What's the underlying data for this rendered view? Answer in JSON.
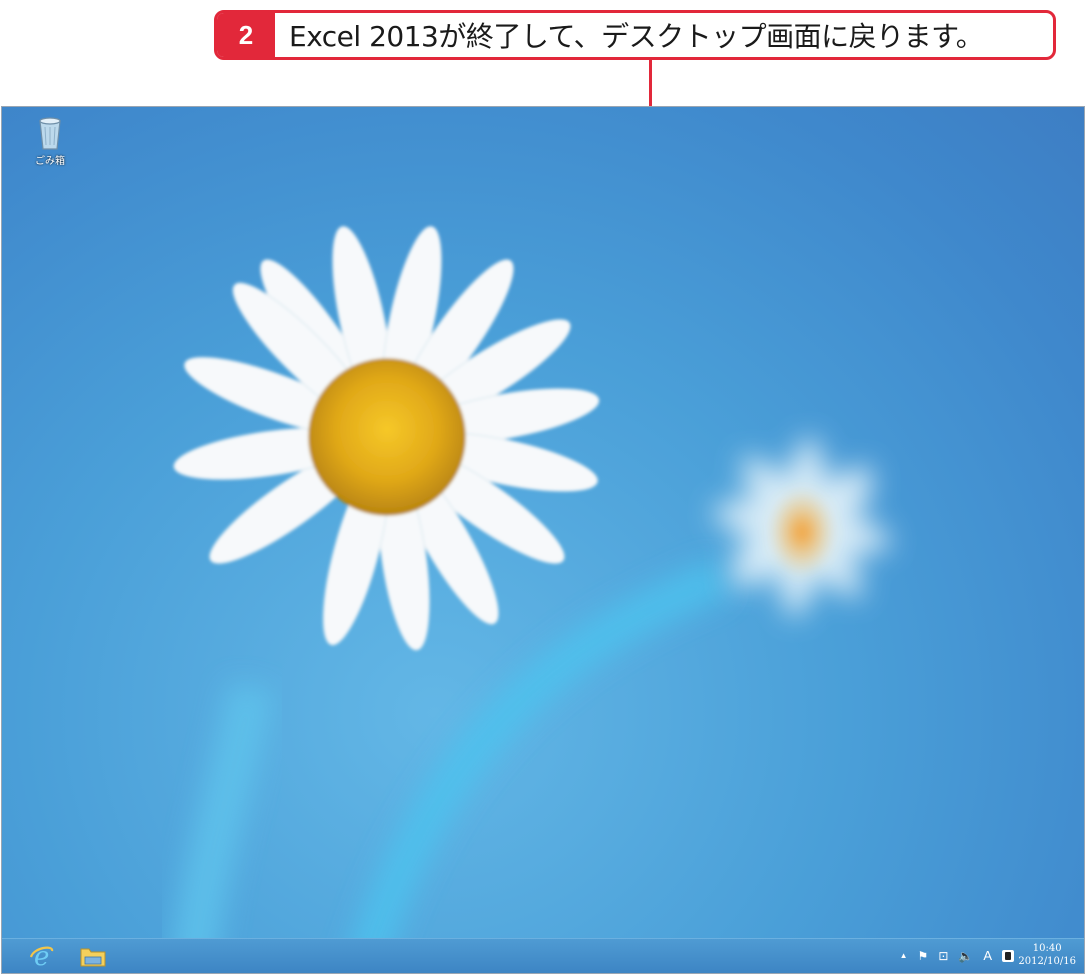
{
  "callout": {
    "step": "2",
    "text": "Excel 2013が終了して、デスクトップ画面に戻ります。"
  },
  "desktop": {
    "icons": [
      {
        "label": "ごみ箱",
        "icon": "recycle-bin-icon"
      }
    ]
  },
  "taskbar": {
    "pinned": [
      {
        "name": "Internet Explorer",
        "icon": "internet-explorer-icon"
      },
      {
        "name": "File Explorer",
        "icon": "folder-icon"
      }
    ],
    "tray": {
      "show_hidden": "▲",
      "flag": "⚑",
      "network": "⊡",
      "volume": "🔈",
      "ime_mode": "A",
      "ime_icon": "ime-icon"
    },
    "clock": {
      "time": "10:40",
      "date": "2012/10/16"
    }
  },
  "colors": {
    "callout_accent": "#e2283a",
    "taskbar": "#3d85c4",
    "wallpaper_sky": "#4a9fd8"
  }
}
